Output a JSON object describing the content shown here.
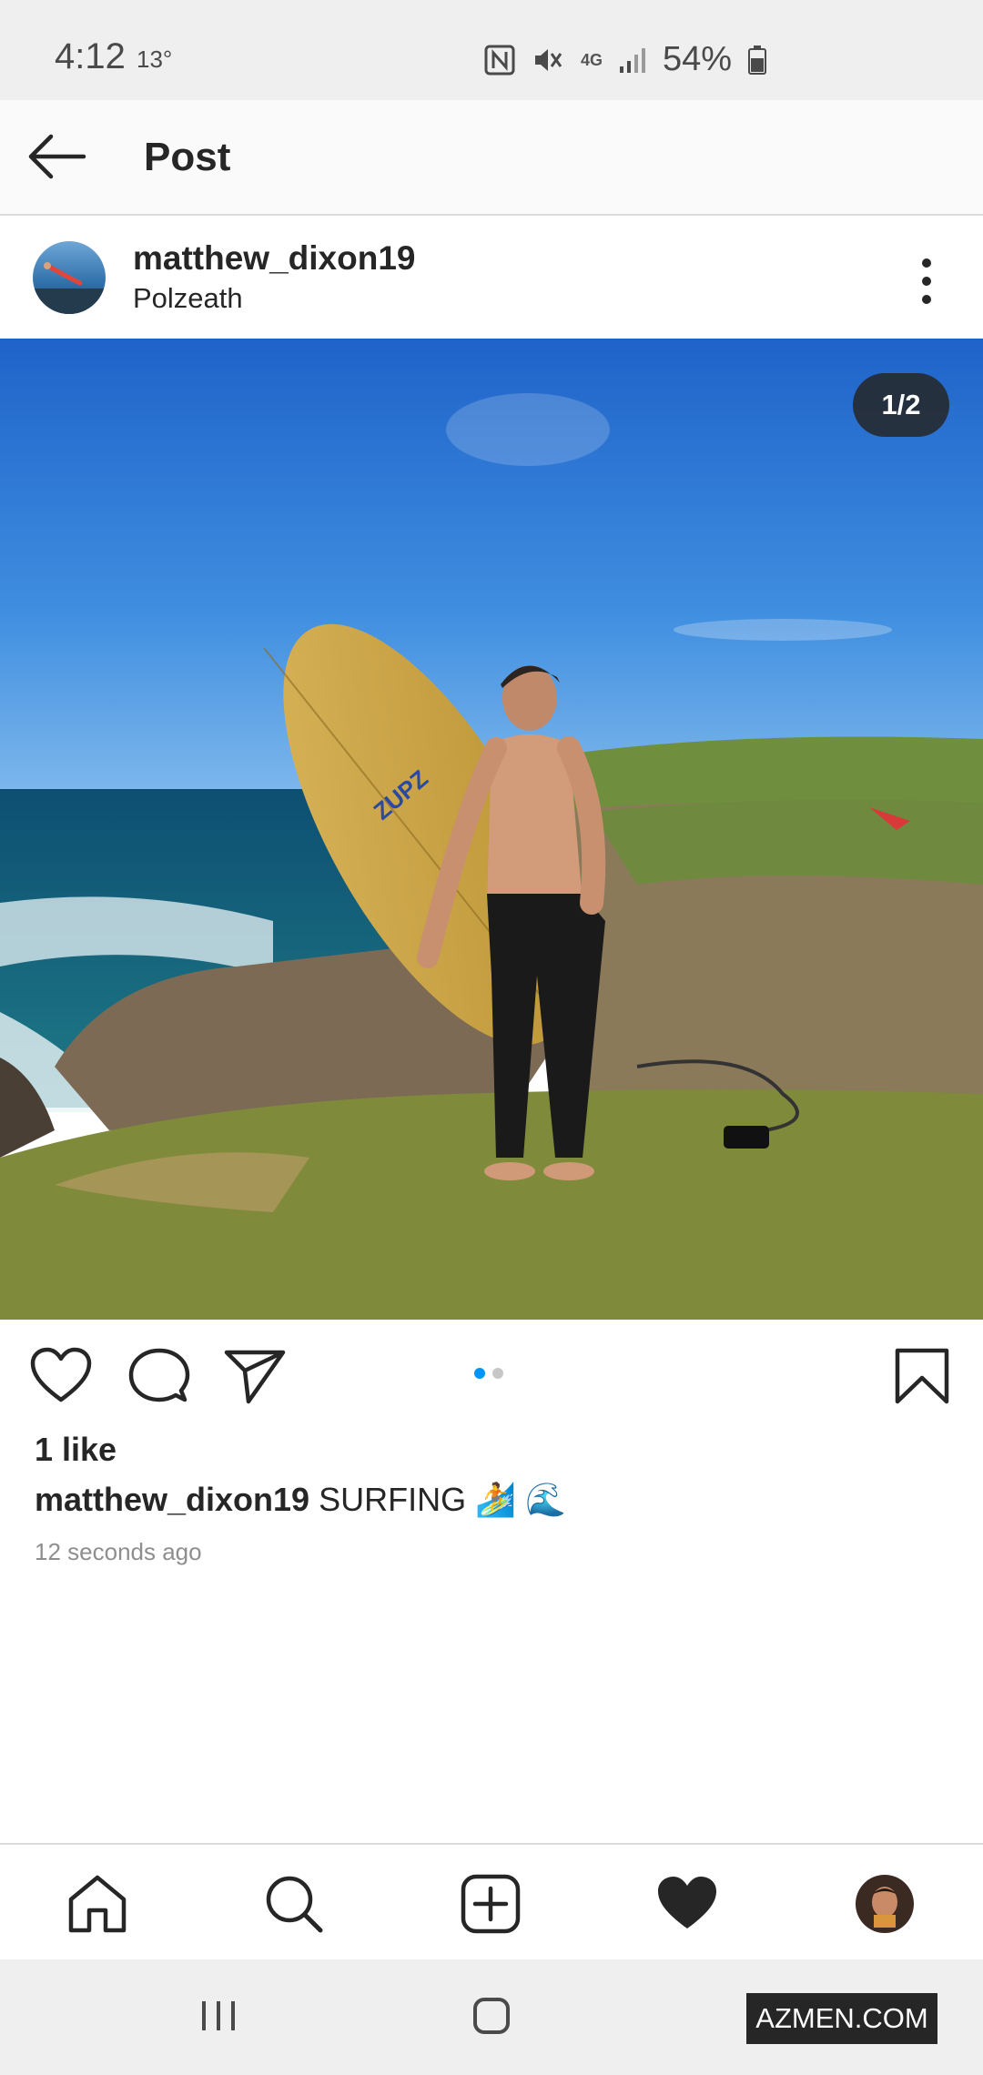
{
  "status_bar": {
    "time": "4:12",
    "temperature": "13°",
    "network": "4G",
    "battery": "54%"
  },
  "app_bar": {
    "title": "Post"
  },
  "post": {
    "username": "matthew_dixon19",
    "location": "Polzeath",
    "image_counter": "1/2",
    "likes": "1 like",
    "caption_user": "matthew_dixon19",
    "caption_text": "SURFING 🏄 🌊",
    "timestamp": "12 seconds ago",
    "carousel_index": 1,
    "carousel_total": 2
  },
  "bottom_nav": {
    "items": [
      "home-icon",
      "search-icon",
      "new-post-icon",
      "activity-heart-icon",
      "profile-avatar"
    ]
  },
  "watermark": "AZMEN.COM",
  "colors": {
    "accent_blue": "#0095f6",
    "text": "#262626",
    "muted": "#8e8e8e",
    "status_bg": "#efefef"
  }
}
